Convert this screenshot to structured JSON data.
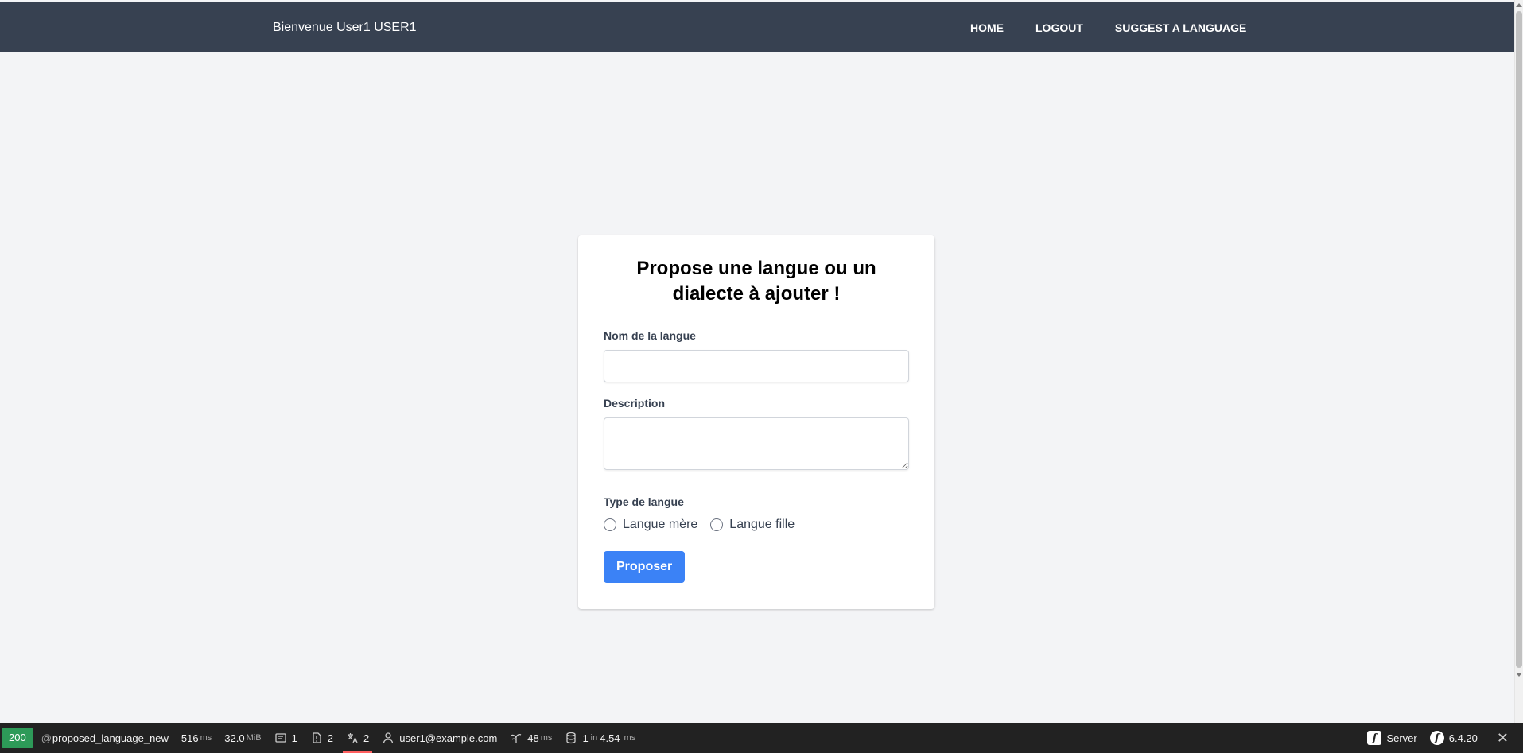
{
  "header": {
    "welcome": "Bienvenue User1 USER1",
    "nav": [
      {
        "label": "HOME"
      },
      {
        "label": "LOGOUT"
      },
      {
        "label": "SUGGEST A LANGUAGE"
      }
    ]
  },
  "form": {
    "title": "Propose une langue ou un dialecte à ajouter !",
    "name_label": "Nom de la langue",
    "name_value": "",
    "description_label": "Description",
    "description_value": "",
    "type_label": "Type de langue",
    "type_options": [
      {
        "label": "Langue mère",
        "checked": false
      },
      {
        "label": "Langue fille",
        "checked": false
      }
    ],
    "submit_label": "Proposer",
    "accent_color": "#3b82f6"
  },
  "toolbar": {
    "status_code": "200",
    "route_prefix": "@",
    "route": "proposed_language_new",
    "time_value": "516",
    "time_unit": "ms",
    "memory_value": "32.0",
    "memory_unit": "MiB",
    "forms_count": "1",
    "logs_count": "2",
    "translations_count": "2",
    "user": "user1@example.com",
    "twig_value": "48",
    "twig_unit": "ms",
    "db_queries": "1",
    "db_in": "in",
    "db_time": "4.54",
    "db_unit": "ms",
    "server_label": "Server",
    "symfony_version": "6.4.20",
    "status_color": "#2d9a58"
  }
}
